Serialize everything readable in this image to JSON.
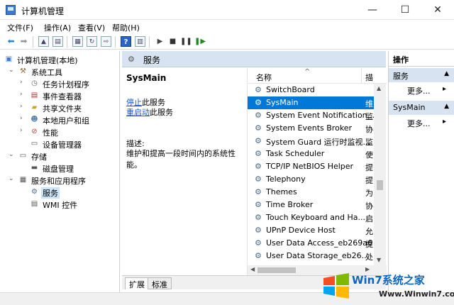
{
  "window": {
    "title": "计算机管理",
    "minimize": "—",
    "maximize": "☐",
    "close": "✕"
  },
  "menu": [
    "文件(F)",
    "操作(A)",
    "查看(V)",
    "帮助(H)"
  ],
  "tree": {
    "root": "计算机管理(本地)",
    "system_tools": "系统工具",
    "task_scheduler": "任务计划程序",
    "event_viewer": "事件查看器",
    "shared_folders": "共享文件夹",
    "local_users": "本地用户和组",
    "performance": "性能",
    "device_manager": "设备管理器",
    "storage": "存储",
    "disk_management": "磁盘管理",
    "services_apps": "服务和应用程序",
    "services": "服务",
    "wmi": "WMI 控件"
  },
  "center": {
    "header": "服务",
    "selected_service": "SysMain",
    "stop_link": "停止",
    "stop_suffix": "此服务",
    "restart_link": "重启动",
    "restart_suffix": "此服务",
    "desc_label": "描述:",
    "desc_text": "维护和提高一段时间内的系统性能。"
  },
  "list": {
    "col_name": "名称",
    "col_desc": "描",
    "sort_indicator": "^",
    "rows": [
      {
        "name": "SwitchBoard",
        "desc": ""
      },
      {
        "name": "SysMain",
        "desc": "维"
      },
      {
        "name": "System Event Notification...",
        "desc": "监"
      },
      {
        "name": "System Events Broker",
        "desc": "协"
      },
      {
        "name": "System Guard 运行时监视...",
        "desc": "监"
      },
      {
        "name": "Task Scheduler",
        "desc": "使"
      },
      {
        "name": "TCP/IP NetBIOS Helper",
        "desc": "提"
      },
      {
        "name": "Telephony",
        "desc": "提"
      },
      {
        "name": "Themes",
        "desc": "为"
      },
      {
        "name": "Time Broker",
        "desc": "协"
      },
      {
        "name": "Touch Keyboard and Ha...",
        "desc": "启"
      },
      {
        "name": "UPnP Device Host",
        "desc": "允"
      },
      {
        "name": "User Data Access_eb269a6",
        "desc": "提"
      },
      {
        "name": "User Data Storage_eb26...",
        "desc": "处"
      }
    ],
    "selected_index": 1
  },
  "tabs": [
    "扩展",
    "标准"
  ],
  "actions": {
    "title": "操作",
    "group1": "服务",
    "group2": "SysMain",
    "more1": "更多...",
    "more2": "更多..."
  },
  "watermark": {
    "title": "Win7系统之家",
    "url": "Www.Winwin7.com"
  },
  "colors": {
    "selection": "#0078d7",
    "header_band": "#d7e3f0",
    "link": "#1a55c4"
  }
}
